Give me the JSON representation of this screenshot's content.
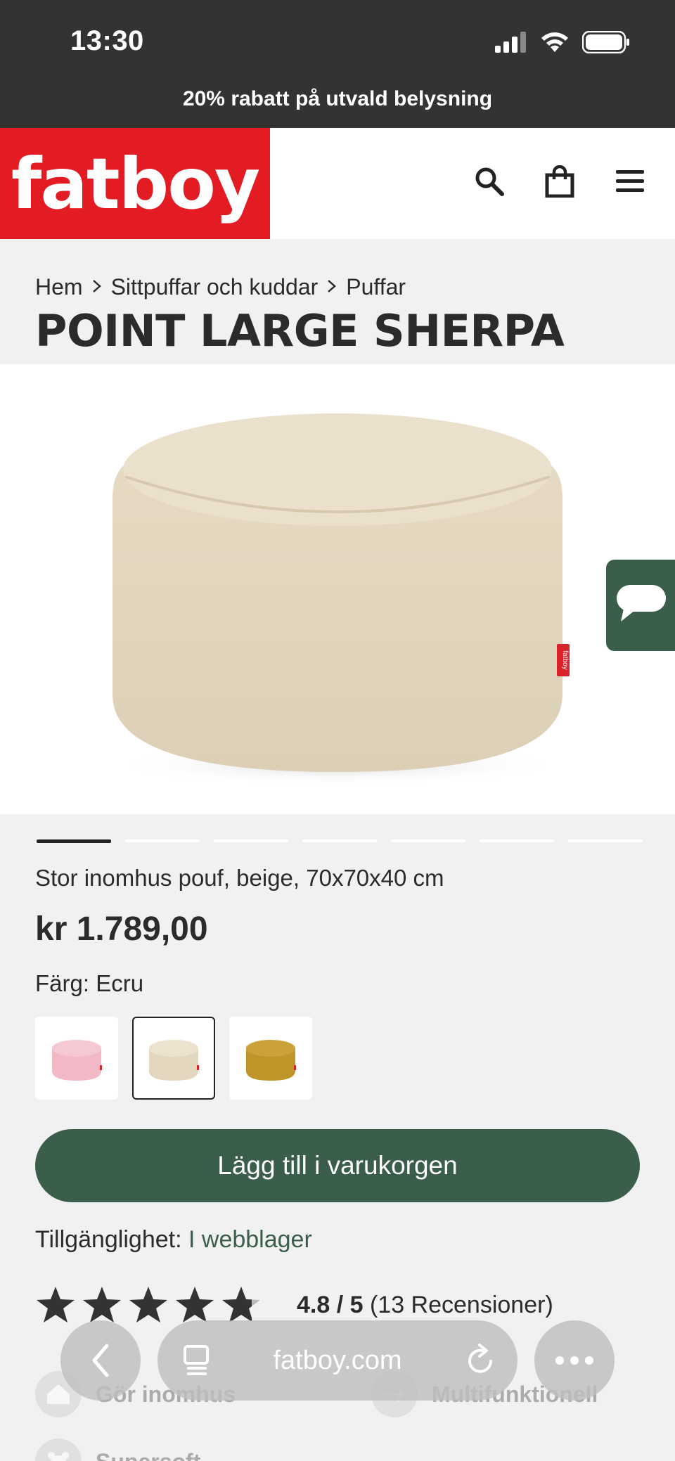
{
  "status_bar": {
    "time": "13:30"
  },
  "promo": {
    "text": "20% rabatt på utvald belysning"
  },
  "header": {
    "logo": "fatboy",
    "icons": [
      "search-icon",
      "shopping-bag-icon",
      "menu-icon"
    ]
  },
  "breadcrumb": {
    "items": [
      "Hem",
      "Sittpuffar och kuddar",
      "Puffar"
    ],
    "separator": ">"
  },
  "product": {
    "title": "POINT LARGE SHERPA",
    "image_label": "fatboy",
    "subtitle": "Stor inomhus pouf, beige, 70x70x40 cm",
    "price": "kr 1.789,00",
    "color_label": "Färg: Ecru",
    "swatches": [
      {
        "name": "pink",
        "color": "#f2b8c6"
      },
      {
        "name": "ecru",
        "color": "#e8dcc4",
        "selected": true
      },
      {
        "name": "mustard",
        "color": "#c49a2c"
      }
    ],
    "add_to_cart": "Lägg till i varukorgen",
    "availability_label": "Tillgänglighet:",
    "availability_value": "I webblager",
    "rating_score": "4.8 / 5",
    "rating_count": "(13 Recensioner)"
  },
  "gallery": {
    "count": 7,
    "active": 0
  },
  "features": {
    "left": "Gör inomhus",
    "right": "Multifunktionell",
    "bottom": "Supersoft"
  },
  "browser": {
    "url": "fatboy.com"
  },
  "colors": {
    "brand_red": "#e31b23",
    "brand_green": "#3a5e4a",
    "dark": "#333333"
  }
}
